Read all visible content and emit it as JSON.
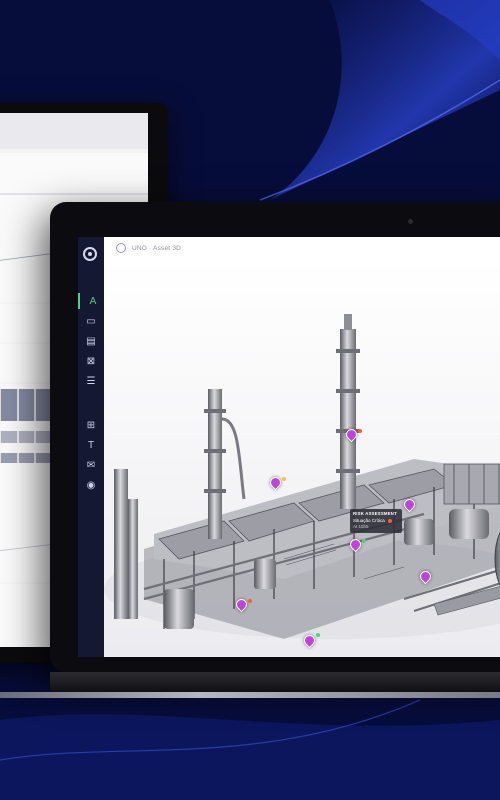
{
  "app": {
    "header_title": "UNO · Asset 3D"
  },
  "back_window": {
    "close_glyph": "×"
  },
  "sidebar": {
    "items": [
      {
        "icon": "a-icon",
        "glyph": "A"
      },
      {
        "icon": "box-icon",
        "glyph": "▭"
      },
      {
        "icon": "clipboard-icon",
        "glyph": "▤"
      },
      {
        "icon": "network-icon",
        "glyph": "⊠"
      },
      {
        "icon": "list-icon",
        "glyph": "☰"
      },
      {
        "icon": "chart-icon",
        "glyph": "⊞"
      },
      {
        "icon": "text-icon",
        "glyph": "T"
      },
      {
        "icon": "mail-icon",
        "glyph": "✉"
      },
      {
        "icon": "chat-icon",
        "glyph": "◉"
      }
    ]
  },
  "tooltip": {
    "title": "RISK ASSESSMENT",
    "status": "Situação Crítica",
    "extra": "At 15h5"
  },
  "colors": {
    "sidebar_bg": "#141833",
    "accent_green": "#4fd37a",
    "marker_purple": "#c043e0",
    "critical": "#ff5a3a"
  }
}
